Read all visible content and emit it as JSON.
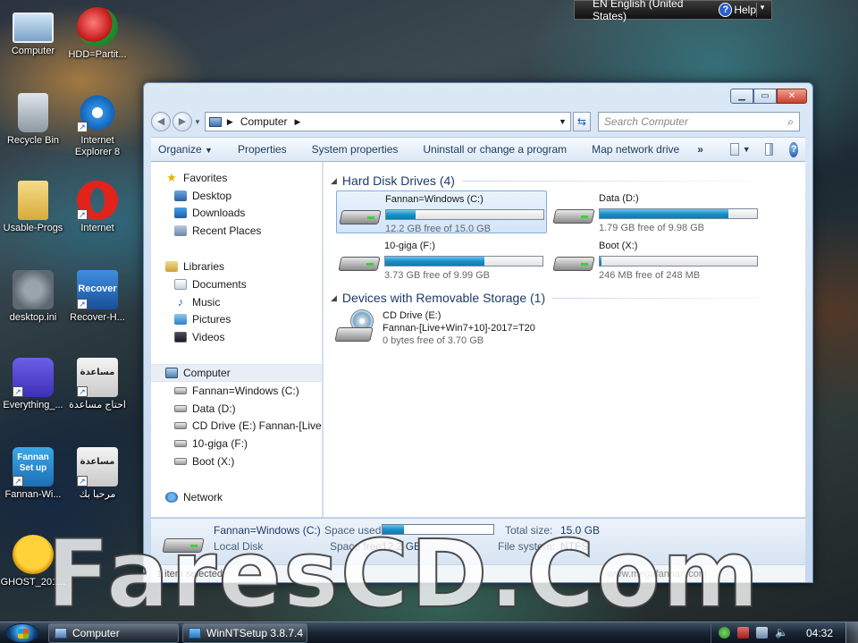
{
  "desktop": {
    "icons": [
      {
        "label": "Computer"
      },
      {
        "label": "HDD=Partit..."
      },
      {
        "label": "Recycle Bin"
      },
      {
        "label": "Internet Explorer 8"
      },
      {
        "label": "Usable-Progs"
      },
      {
        "label": "Internet"
      },
      {
        "label": "desktop.ini"
      },
      {
        "label": "Recover-H..."
      },
      {
        "label": "Everything_..."
      },
      {
        "label": "احتاج مساعدة",
        "icon_text": "مساعدة"
      },
      {
        "label": "Fannan-Wi...",
        "icon_text": "Fannan Set up"
      },
      {
        "label": "مرحبا بك",
        "icon_text": "مساعدة"
      },
      {
        "label": "GHOST_201..."
      }
    ],
    "recover_icon_text": "Recover"
  },
  "langbar": {
    "lang": "EN English (United States)",
    "help": "Help",
    "help_icon": "?"
  },
  "window": {
    "address": {
      "location": "Computer"
    },
    "search_placeholder": "Search Computer",
    "toolbar": {
      "organize": "Organize",
      "properties": "Properties",
      "system_properties": "System properties",
      "uninstall": "Uninstall or change a program",
      "map_network_drive": "Map network drive",
      "more": "»"
    },
    "nav": {
      "favorites": "Favorites",
      "desktop": "Desktop",
      "downloads": "Downloads",
      "recent_places": "Recent Places",
      "libraries": "Libraries",
      "documents": "Documents",
      "music": "Music",
      "pictures": "Pictures",
      "videos": "Videos",
      "computer": "Computer",
      "drive_c": "Fannan=Windows (C:)",
      "drive_d": "Data (D:)",
      "drive_e": "CD Drive (E:) Fannan-[Live+W",
      "drive_f": "10-giga (F:)",
      "drive_x": "Boot (X:)",
      "network": "Network"
    },
    "groups": {
      "hdd": "Hard Disk Drives (4)",
      "removable": "Devices with Removable Storage (1)"
    },
    "drives": [
      {
        "name": "Fannan=Windows (C:)",
        "free": "12.2 GB free of 15.0 GB",
        "used_fraction": 0.19
      },
      {
        "name": "Data (D:)",
        "free": "1.79 GB free of 9.98 GB",
        "used_fraction": 0.82
      },
      {
        "name": "10-giga (F:)",
        "free": "3.73 GB free of 9.99 GB",
        "used_fraction": 0.63
      },
      {
        "name": "Boot (X:)",
        "free": "246 MB free of 248 MB",
        "used_fraction": 0.01
      }
    ],
    "cd": {
      "name": "CD Drive (E:)",
      "label": "Fannan-[Live+Win7+10]-2017=T20",
      "free": "0 bytes free of 3.70 GB"
    },
    "details": {
      "name": "Fannan=Windows (C:)",
      "type": "Local Disk",
      "space_used_label": "Space used:",
      "space_free_label": "Space free:",
      "space_free": "12.2 GB",
      "total_size_label": "Total size:",
      "total_size": "15.0 GB",
      "file_system_label": "File system:",
      "file_system": "NTFS",
      "used_fraction": 0.19
    },
    "status": {
      "selected": "1 item selected",
      "site": "www.megafannan.com"
    }
  },
  "watermark": "FaresCD.Com",
  "taskbar": {
    "items": [
      {
        "label": "Computer"
      },
      {
        "label": "WinNTSetup 3.8.7.4 ..."
      }
    ],
    "clock": "04:32"
  }
}
